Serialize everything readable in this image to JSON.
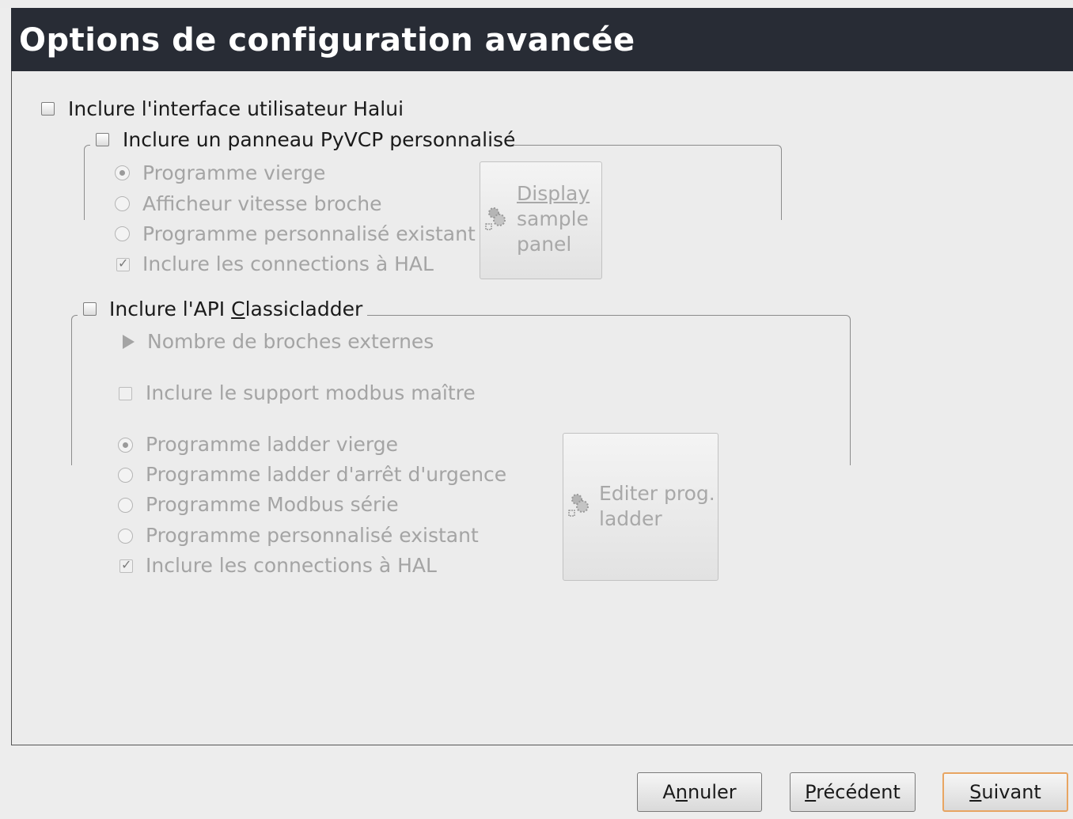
{
  "title": "Options de configuration avancée",
  "halui": {
    "label": "Inclure l'interface utilisateur Halui",
    "checked": false
  },
  "pyvcp": {
    "label": "Inclure un panneau PyVCP personnalisé",
    "checked": false,
    "options": [
      {
        "label": "Programme vierge",
        "selected": true
      },
      {
        "label": "Afficheur vitesse broche",
        "selected": false
      },
      {
        "label": "Programme personnalisé existant",
        "selected": false
      }
    ],
    "hal_connections": {
      "label": "Inclure les connections à HAL",
      "checked": true
    },
    "sample_button": {
      "line1": "Display",
      "line2": "sample",
      "line3": "panel",
      "icon": "gear-icon"
    }
  },
  "classicladder": {
    "label_pre": "Inclure l'API ",
    "label_mnemonic": "C",
    "label_post": "lassicladder",
    "checked": false,
    "expander_label": "Nombre de broches externes",
    "modbus_master": {
      "label": "Inclure le support modbus maître",
      "checked": false
    },
    "options": [
      {
        "label": "Programme ladder vierge",
        "selected": true
      },
      {
        "label": "Programme ladder d'arrêt d'urgence",
        "selected": false
      },
      {
        "label": "Programme Modbus série",
        "selected": false
      },
      {
        "label": "Programme personnalisé existant",
        "selected": false
      }
    ],
    "hal_connections": {
      "label": "Inclure les connections à HAL",
      "checked": true
    },
    "edit_button": {
      "line1": "Editer prog.",
      "line2": "ladder",
      "icon": "gear-icon"
    }
  },
  "footer": {
    "cancel": {
      "pre": "A",
      "mnemonic": "n",
      "post": "nuler"
    },
    "previous": {
      "pre": "",
      "mnemonic": "P",
      "post": "récédent"
    },
    "next": {
      "pre": "",
      "mnemonic": "S",
      "post": "uivant"
    }
  },
  "colors": {
    "titlebar": "#282c35",
    "focus_border": "#e8a562",
    "disabled_text": "#a4a4a4"
  }
}
